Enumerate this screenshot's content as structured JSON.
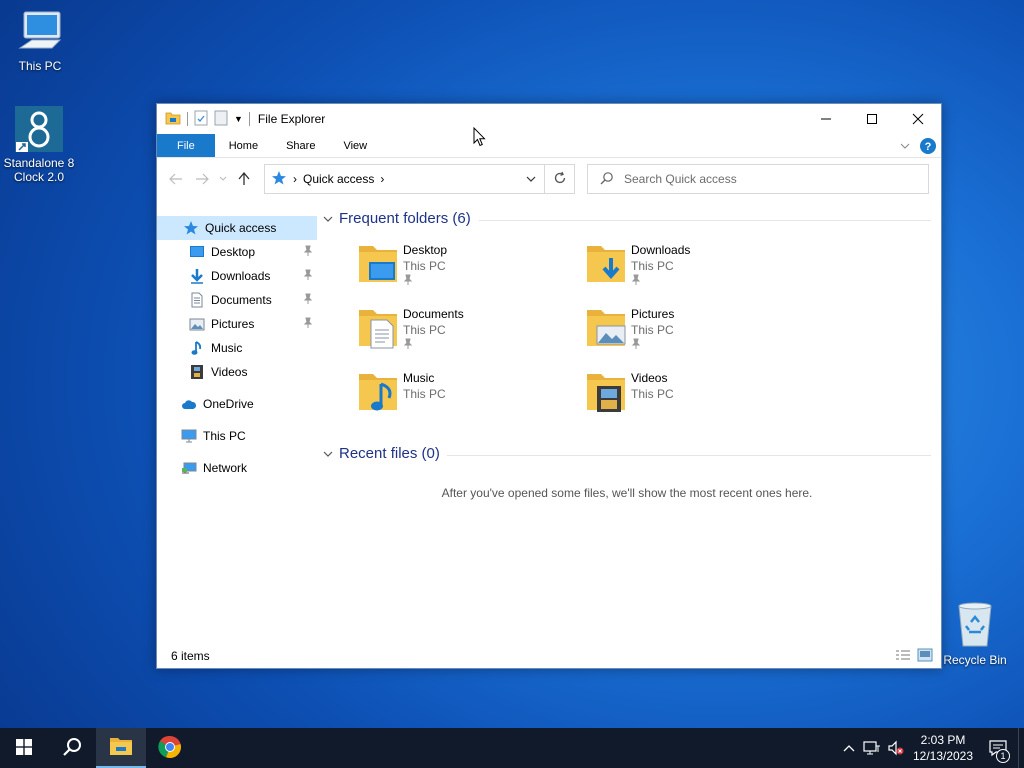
{
  "desktop": {
    "icons": [
      {
        "label": "This PC"
      },
      {
        "label": "Standalone 8 Clock 2.0"
      },
      {
        "label": "Recycle Bin"
      }
    ]
  },
  "window": {
    "title": "File Explorer",
    "ribbon": {
      "tabs": [
        "File",
        "Home",
        "Share",
        "View"
      ]
    },
    "address": {
      "location": "Quick access"
    },
    "search": {
      "placeholder": "Search Quick access"
    },
    "nav": {
      "items": [
        {
          "label": "Quick access",
          "icon": "star-icon",
          "pinned": false,
          "selected": true
        },
        {
          "label": "Desktop",
          "icon": "desktop-folder-icon",
          "pinned": true
        },
        {
          "label": "Downloads",
          "icon": "download-arrow-icon",
          "pinned": true
        },
        {
          "label": "Documents",
          "icon": "document-icon",
          "pinned": true
        },
        {
          "label": "Pictures",
          "icon": "picture-icon",
          "pinned": true
        },
        {
          "label": "Music",
          "icon": "music-note-icon",
          "pinned": false
        },
        {
          "label": "Videos",
          "icon": "film-icon",
          "pinned": false
        },
        {
          "label": "OneDrive",
          "icon": "cloud-icon",
          "pinned": false
        },
        {
          "label": "This PC",
          "icon": "computer-icon",
          "pinned": false
        },
        {
          "label": "Network",
          "icon": "network-icon",
          "pinned": false
        }
      ]
    },
    "frequent": {
      "header": "Frequent folders (6)",
      "folders": [
        {
          "name": "Desktop",
          "location": "This PC",
          "pinned": true
        },
        {
          "name": "Downloads",
          "location": "This PC",
          "pinned": true
        },
        {
          "name": "Documents",
          "location": "This PC",
          "pinned": true
        },
        {
          "name": "Pictures",
          "location": "This PC",
          "pinned": true
        },
        {
          "name": "Music",
          "location": "This PC",
          "pinned": false
        },
        {
          "name": "Videos",
          "location": "This PC",
          "pinned": false
        }
      ]
    },
    "recent": {
      "header": "Recent files (0)",
      "empty_message": "After you've opened some files, we'll show the most recent ones here."
    },
    "status": {
      "items": "6 items"
    }
  },
  "taskbar": {
    "time": "2:03 PM",
    "date": "12/13/2023",
    "notification_count": "1"
  },
  "colors": {
    "accent": "#1979ca",
    "selection": "#cce8ff",
    "folder": "#f5c74f",
    "header_text": "#1e3287"
  }
}
